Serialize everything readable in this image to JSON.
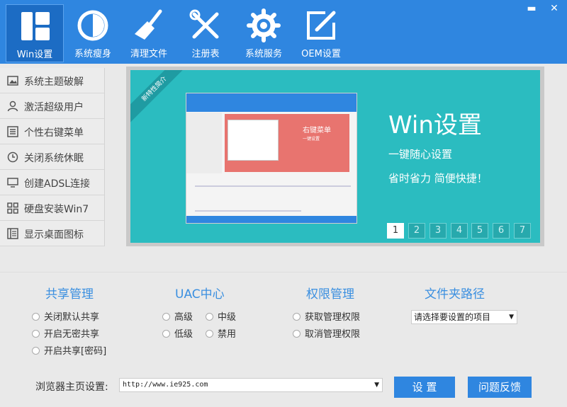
{
  "window_controls": {
    "minimize": "▬",
    "close": "✕"
  },
  "tabs": [
    {
      "label": "Win设置",
      "icon": "windows-grid-icon",
      "active": true
    },
    {
      "label": "系统瘦身",
      "icon": "pie-icon"
    },
    {
      "label": "清理文件",
      "icon": "broom-icon"
    },
    {
      "label": "注册表",
      "icon": "tools-icon"
    },
    {
      "label": "系统服务",
      "icon": "gear-icon"
    },
    {
      "label": "OEM设置",
      "icon": "edit-icon"
    }
  ],
  "sidebar": {
    "items": [
      {
        "label": "系统主题破解",
        "icon": "image-icon"
      },
      {
        "label": "激活超级用户",
        "icon": "user-icon"
      },
      {
        "label": "个性右键菜单",
        "icon": "list-icon"
      },
      {
        "label": "关闭系统休眠",
        "icon": "clock-icon"
      },
      {
        "label": "创建ADSL连接",
        "icon": "monitor-icon"
      },
      {
        "label": "硬盘安装Win7",
        "icon": "grid-icon"
      },
      {
        "label": "显示桌面图标",
        "icon": "book-icon"
      }
    ]
  },
  "banner": {
    "ribbon": "新特性简介",
    "title": "Win设置",
    "line1": "一键随心设置",
    "line2": "省时省力  简便快捷！",
    "preview_title": "右键菜单",
    "preview_sub": "一键设置",
    "pages": [
      "1",
      "2",
      "3",
      "4",
      "5",
      "6",
      "7"
    ],
    "active_page": "1"
  },
  "groups": {
    "share": {
      "title": "共享管理",
      "options": [
        "关闭默认共享",
        "开启无密共享",
        "开启共享[密码]"
      ]
    },
    "uac": {
      "title": "UAC中心",
      "options": [
        "高级",
        "中级",
        "低级",
        "禁用"
      ]
    },
    "perm": {
      "title": "权限管理",
      "options": [
        "获取管理权限",
        "取消管理权限"
      ]
    },
    "folder": {
      "title": "文件夹路径",
      "select_value": "请选择要设置的项目"
    }
  },
  "browser": {
    "label": "浏览器主页设置:",
    "url": "http://www.ie925.com",
    "set_button": "设 置",
    "feedback_button": "问题反馈"
  },
  "colors": {
    "accent": "#2f86e0",
    "banner_bg": "#2bbcc0",
    "heading": "#3a8fe0"
  }
}
